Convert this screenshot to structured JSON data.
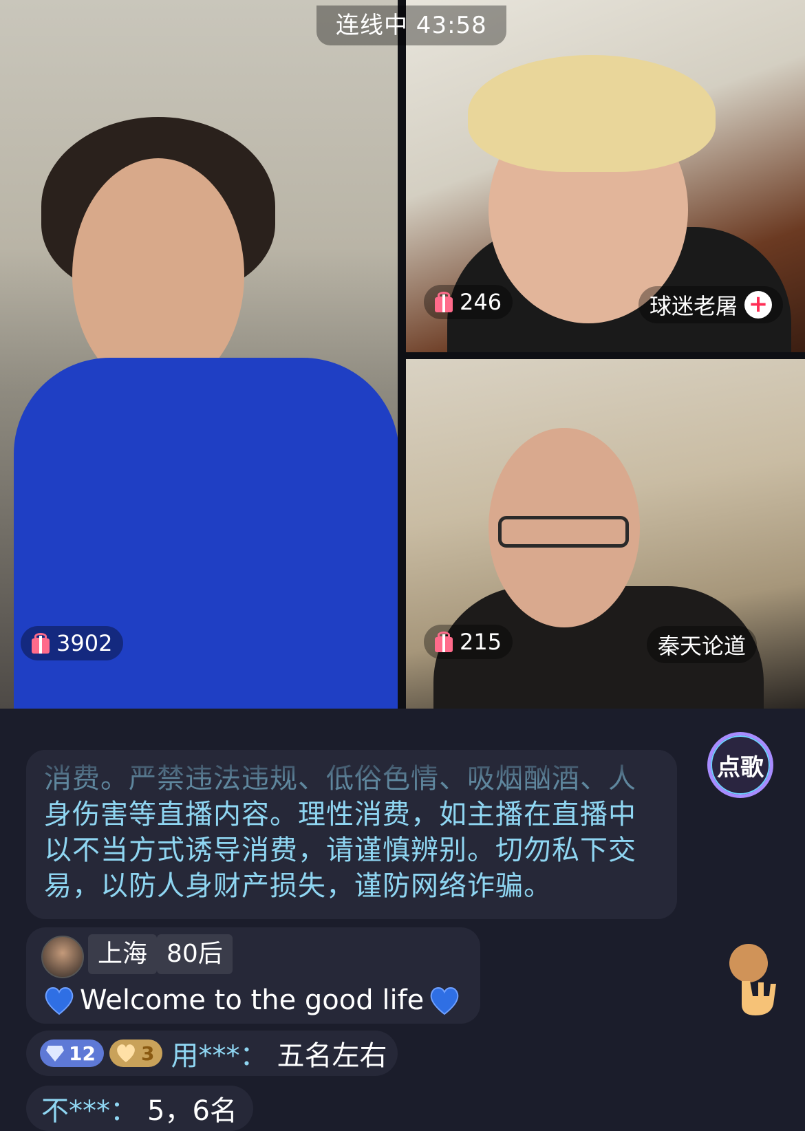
{
  "status": {
    "timer": "连线中 43:58"
  },
  "guests": [
    {
      "gifts": "3902"
    },
    {
      "gifts": "246",
      "name": "球迷老屠",
      "follow": "+"
    },
    {
      "gifts": "215",
      "name": "秦天论道"
    }
  ],
  "song_button": "点歌",
  "notice_top": "消费。严禁违法违规、低俗色情、吸烟酗酒、人",
  "notice": "身伤害等直播内容。理性消费，如主播在直播中以不当方式诱导消费，请谨慎辨别。切勿私下交易，以防人身财产损失，谨防网络诈骗。",
  "welcome": {
    "tags": [
      "上海",
      "80后"
    ],
    "text": "Welcome to the good life"
  },
  "messages": [
    {
      "level": "12",
      "fan_level": "3",
      "user": "用***：",
      "text": "五名左右"
    },
    {
      "user": "不***：",
      "text": "5，6名"
    }
  ],
  "colors": {
    "accent": "#8fd6f2",
    "gift": "#ff6b8b",
    "bg": "#1b1d2b",
    "bubble": "#262838"
  }
}
